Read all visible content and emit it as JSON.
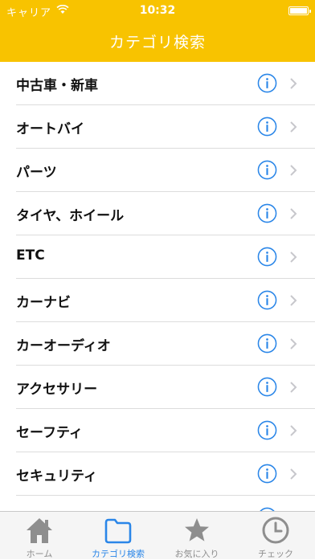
{
  "status_bar": {
    "carrier": "キャリア",
    "time": "10:32"
  },
  "header": {
    "title": "カテゴリ検索"
  },
  "categories": [
    {
      "label": "中古車・新車"
    },
    {
      "label": "オートバイ"
    },
    {
      "label": "パーツ"
    },
    {
      "label": "タイヤ、ホイール"
    },
    {
      "label": "ETC"
    },
    {
      "label": "カーナビ"
    },
    {
      "label": "カーオーディオ"
    },
    {
      "label": "アクセサリー"
    },
    {
      "label": "セーフティ"
    },
    {
      "label": "セキュリティ"
    },
    {
      "label": ""
    }
  ],
  "tab_bar": {
    "tabs": [
      {
        "label": "ホーム",
        "icon": "home-icon"
      },
      {
        "label": "カテゴリ検索",
        "icon": "folder-icon",
        "active": true
      },
      {
        "label": "お気に入り",
        "icon": "star-icon"
      },
      {
        "label": "チェック",
        "icon": "clock-icon"
      }
    ]
  },
  "colors": {
    "header": "#f8c300",
    "accent": "#2a86e8",
    "inactive": "#8e8e8e"
  }
}
